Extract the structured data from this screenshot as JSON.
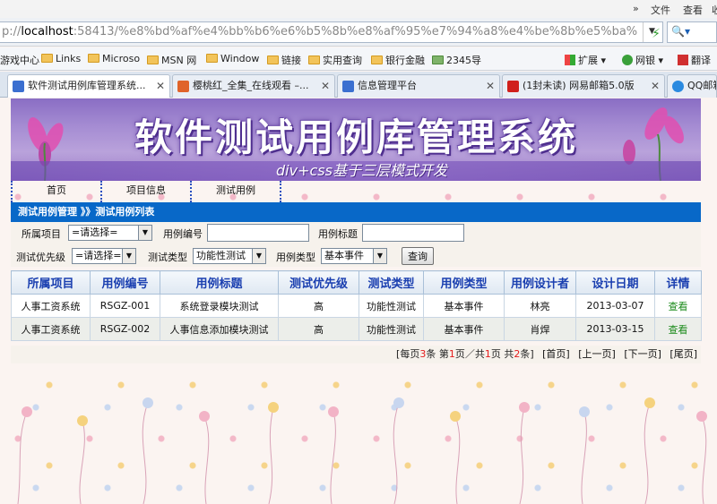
{
  "browser": {
    "menu": [
      "»",
      "文件",
      "查看",
      "收"
    ],
    "address": {
      "scheme": "p://",
      "host": "localhost",
      "rest": ":58413/%e8%bd%af%e4%bb%b6%e6%b5%8b%e8%af%95%e7%94%a8%e4%be%8b%e5%ba%"
    },
    "favorites": [
      "游戏中心",
      "Links",
      "Microso",
      "MSN 网",
      "Window",
      "链接",
      "实用查询",
      "银行金融",
      "2345导"
    ],
    "favorites_right": [
      "扩展",
      "网银",
      "翻译"
    ],
    "tabs": [
      {
        "label": "软件测试用例库管理系统...",
        "icon_color": "#3b6fd0",
        "active": true
      },
      {
        "label": "樱桃红_全集_在线观看 –...",
        "icon_color": "#e0632a",
        "active": false
      },
      {
        "label": "信息管理平台",
        "icon_color": "#3b6fd0",
        "active": false
      },
      {
        "label": "(1封未读) 网易邮箱5.0版",
        "icon_color": "#d0201c",
        "active": false
      },
      {
        "label": "QQ邮箱",
        "icon_color": "#2a8ae0",
        "active": false
      }
    ]
  },
  "banner": {
    "title": "软件测试用例库管理系统",
    "subtitle": "div+css基于三层模式开发"
  },
  "nav": [
    "首页",
    "项目信息",
    "测试用例"
  ],
  "breadcrumb": "测试用例管理 》》测试用例列表",
  "filters": {
    "project_label": "所属项目",
    "project_value": "=请选择=",
    "case_no_label": "用例编号",
    "case_no_value": "",
    "case_title_label": "用例标题",
    "case_title_value": "",
    "priority_label": "测试优先级",
    "priority_value": "=请选择=",
    "test_type_label": "测试类型",
    "test_type_value": "功能性测试",
    "case_type_label": "用例类型",
    "case_type_value": "基本事件",
    "query_button": "查询"
  },
  "table": {
    "headers": [
      "所属项目",
      "用例编号",
      "用例标题",
      "测试优先级",
      "测试类型",
      "用例类型",
      "用例设计者",
      "设计日期",
      "详情"
    ],
    "rows": [
      [
        "人事工资系统",
        "RSGZ-001",
        "系统登录模块测试",
        "高",
        "功能性测试",
        "基本事件",
        "林亮",
        "2013-03-07",
        "查看"
      ],
      [
        "人事工资系统",
        "RSGZ-002",
        "人事信息添加模块测试",
        "高",
        "功能性测试",
        "基本事件",
        "肖焊",
        "2013-03-15",
        "查看"
      ]
    ]
  },
  "pager": {
    "per_page_pre": "[每页",
    "per_page": "3",
    "per_page_post": "条 第",
    "current": "1",
    "mid": "页／共",
    "total_pages": "1",
    "mid2": "页 共",
    "total": "2",
    "end": "条]",
    "first": "[首页]",
    "prev": "[上一页]",
    "next": "[下一页]",
    "last": "[尾页]"
  }
}
